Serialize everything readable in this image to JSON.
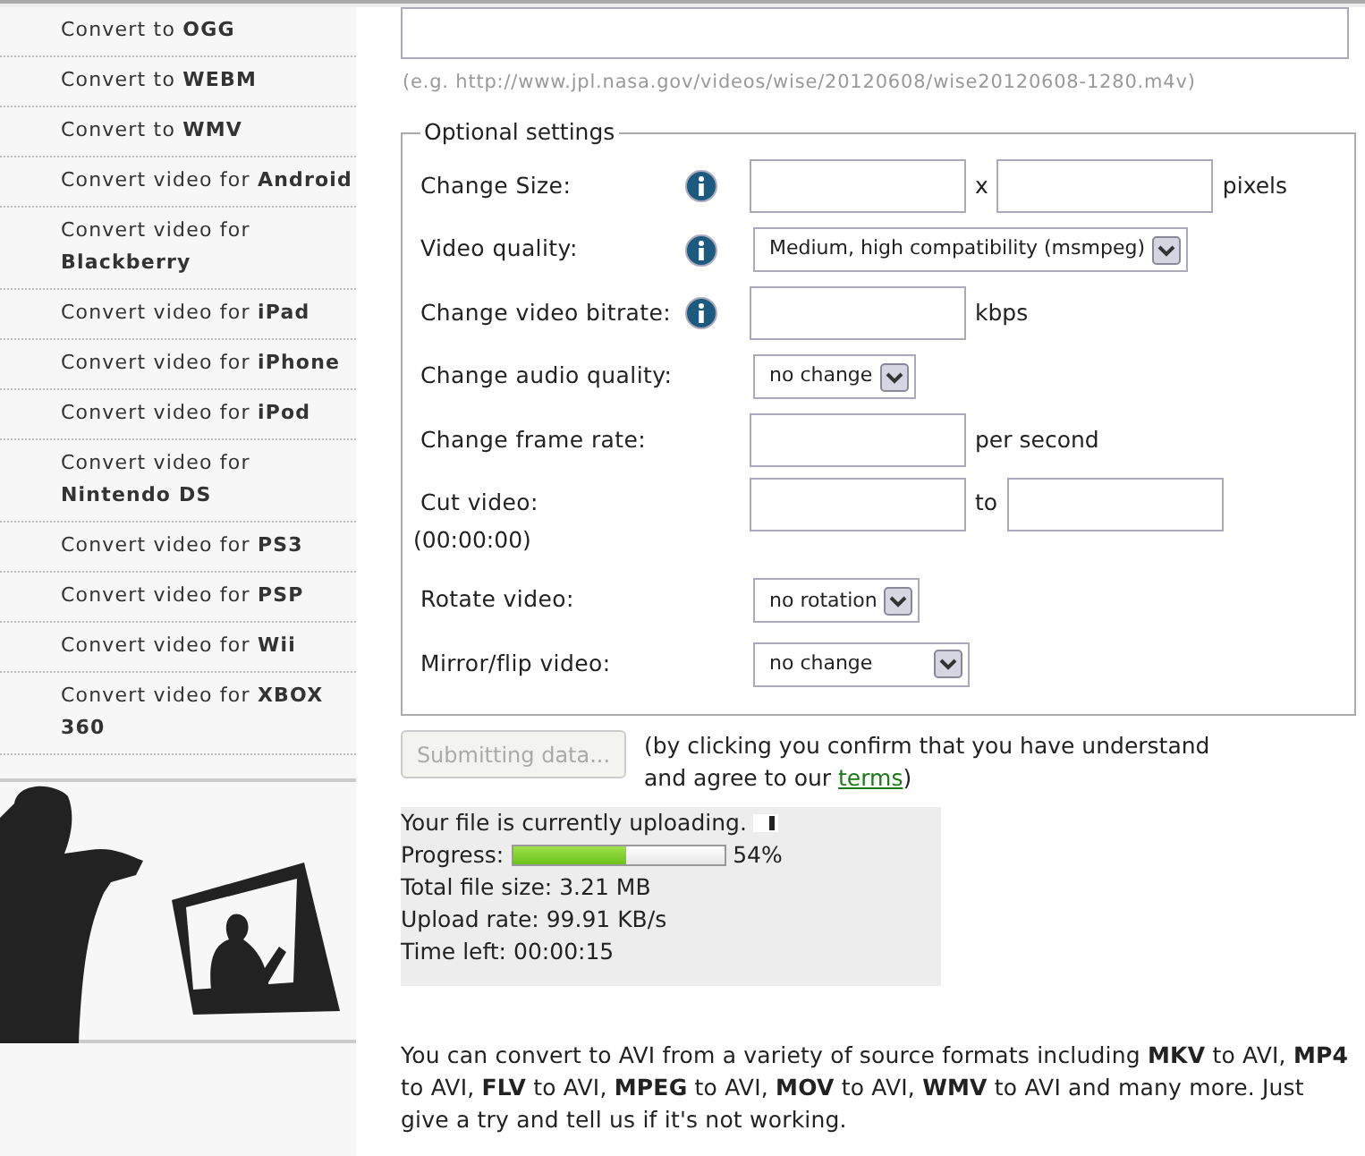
{
  "sidebar": {
    "items": [
      {
        "label": "Convert to **OGG**"
      },
      {
        "label": "Convert to **WEBM**"
      },
      {
        "label": "Convert to **WMV**"
      },
      {
        "label": "Convert video for **Android**"
      },
      {
        "label": "Convert video for **Blackberry**"
      },
      {
        "label": "Convert video for **iPad**"
      },
      {
        "label": "Convert video for **iPhone**"
      },
      {
        "label": "Convert video for **iPod**"
      },
      {
        "label": "Convert video for **Nintendo DS**"
      },
      {
        "label": "Convert video for **PS3**"
      },
      {
        "label": "Convert video for **PSP**"
      },
      {
        "label": "Convert video for **Wii**"
      },
      {
        "label": "Convert video for **XBOX 360**"
      }
    ]
  },
  "url_field": {
    "hint": "(e.g. http://www.jpl.nasa.gov/videos/wise/20120608/wise20120608-1280.m4v)"
  },
  "optional_settings": {
    "legend": "Optional settings",
    "rows": [
      {
        "label": "Change Size:",
        "info": true,
        "controls": [
          {
            "kind": "input"
          },
          {
            "kind": "text",
            "text": "x"
          },
          {
            "kind": "input"
          },
          {
            "kind": "text",
            "text": "pixels"
          }
        ]
      },
      {
        "label": "Video quality:",
        "info": true,
        "controls": [
          {
            "kind": "select",
            "value": "Medium, high compatibility (msmpeg)"
          }
        ]
      },
      {
        "label": "Change video bitrate:",
        "info": true,
        "controls": [
          {
            "kind": "input"
          },
          {
            "kind": "text",
            "text": "kbps"
          }
        ]
      },
      {
        "label": "Change audio quality:",
        "info": false,
        "controls": [
          {
            "kind": "select",
            "value": "no change"
          }
        ]
      },
      {
        "label": "Change frame rate:",
        "info": false,
        "controls": [
          {
            "kind": "input"
          },
          {
            "kind": "text",
            "text": "per second"
          }
        ]
      },
      {
        "label": "Cut video:",
        "info": false,
        "note": "(00:00:00)",
        "controls": [
          {
            "kind": "input"
          },
          {
            "kind": "text",
            "text": "to"
          },
          {
            "kind": "input"
          }
        ]
      },
      {
        "label": "Rotate video:",
        "info": false,
        "controls": [
          {
            "kind": "select",
            "value": "no rotation"
          }
        ]
      },
      {
        "label": "Mirror/flip video:",
        "info": false,
        "controls": [
          {
            "kind": "select",
            "value": "no change",
            "wide": true
          }
        ]
      }
    ]
  },
  "submit": {
    "label": "Submitting data...",
    "disabled": true,
    "note_before": "(by clicking you confirm that you have understand and agree to our",
    "link": "terms",
    "note_after": ")"
  },
  "upload": {
    "status": "Your file is currently uploading.",
    "progress_label": "Progress:",
    "level": 0.54,
    "percent": "54%",
    "lines": [
      "Total file size: 3.21 MB",
      "Upload rate: 99.91 KB/s",
      "Time left: 00:00:15"
    ]
  },
  "description": "You can convert to AVI from a variety of source formats including **MKV** to AVI, **MP4** to AVI, **FLV** to AVI, **MPEG** to AVI, **MOV** to AVI, **WMV** to AVI and many more. Just give a try and tell us if it's not working."
}
